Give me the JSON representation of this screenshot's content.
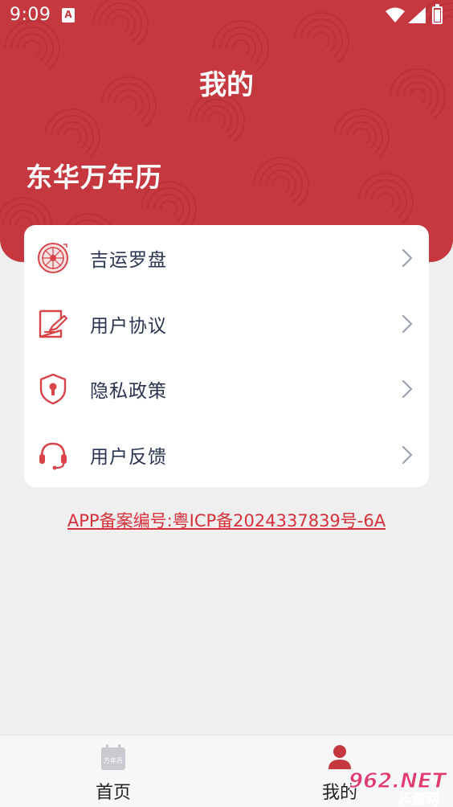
{
  "status_bar": {
    "time": "9:09",
    "notification_glyph": "A",
    "icons": [
      "notification-a-icon",
      "wifi-icon",
      "signal-icon",
      "battery-icon"
    ]
  },
  "header": {
    "title": "我的",
    "app_name": "东华万年历",
    "background_color": "#c5383f"
  },
  "menu": {
    "items": [
      {
        "label": "吉运罗盘",
        "icon": "compass-icon"
      },
      {
        "label": "用户协议",
        "icon": "document-edit-icon"
      },
      {
        "label": "隐私政策",
        "icon": "shield-lock-icon"
      },
      {
        "label": "用户反馈",
        "icon": "headset-icon"
      }
    ]
  },
  "icp": {
    "text": "APP备案编号:粤ICP备2024337839号-6A",
    "color": "#d8303a"
  },
  "tab_bar": {
    "tabs": [
      {
        "label": "首页",
        "icon": "calendar-icon",
        "icon_text": "万年历",
        "active": false
      },
      {
        "label": "我的",
        "icon": "user-icon",
        "active": true
      }
    ],
    "accent_color": "#c5383f"
  },
  "watermark": {
    "brand": "962.NET",
    "sub": "乐游网"
  }
}
